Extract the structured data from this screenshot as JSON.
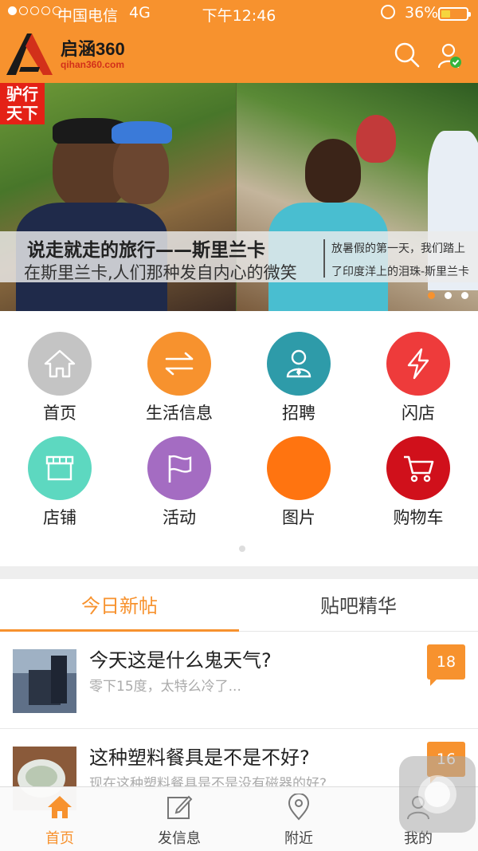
{
  "status_bar": {
    "carrier": "中国电信",
    "network": "4G",
    "time": "下午12:46",
    "battery": "36%",
    "battery_level": 0.36
  },
  "header": {
    "app_name": "启涵360",
    "site": "qihan360.com",
    "icons": [
      "search-icon",
      "user-icon"
    ]
  },
  "banner": {
    "tag": "驴行天下",
    "title": "说走就走的旅行——斯里兰卡",
    "subtitle": "在斯里兰卡,人们那种发自内心的微笑",
    "side_line1": "放暑假的第一天，我们踏上",
    "side_line2": "了印度洋上的泪珠-斯里兰卡",
    "slides": 3,
    "active_slide": 1
  },
  "menu": [
    {
      "label": "首页",
      "icon": "home-icon",
      "color": "#c4c4c4"
    },
    {
      "label": "生活信息",
      "icon": "swap-icon",
      "color": "#f7922e"
    },
    {
      "label": "招聘",
      "icon": "person-icon",
      "color": "#2e9ba9"
    },
    {
      "label": "闪店",
      "icon": "lightning-icon",
      "color": "#ee3b3b"
    },
    {
      "label": "店铺",
      "icon": "store-icon",
      "color": "#5dd8c0"
    },
    {
      "label": "活动",
      "icon": "flag-icon",
      "color": "#a46cc2"
    },
    {
      "label": "图片",
      "icon": "image-icon",
      "color": "#ff7410"
    },
    {
      "label": "购物车",
      "icon": "cart-icon",
      "color": "#d0101b"
    }
  ],
  "tabs": [
    {
      "label": "今日新帖",
      "active": true
    },
    {
      "label": "贴吧精华",
      "active": false
    }
  ],
  "posts": [
    {
      "title": "今天这是什么鬼天气?",
      "desc": "零下15度，太特么冷了...",
      "count": "18"
    },
    {
      "title": "这种塑料餐具是不是不好?",
      "desc": "现在这种塑料餐具是不是没有磁器的好?",
      "count": "16"
    }
  ],
  "bottom_nav": [
    {
      "label": "首页",
      "icon": "home-icon",
      "active": true
    },
    {
      "label": "发信息",
      "icon": "edit-icon",
      "active": false
    },
    {
      "label": "附近",
      "icon": "location-pin-icon",
      "active": false
    },
    {
      "label": "我的",
      "icon": "user-icon",
      "active": false
    }
  ],
  "colors": {
    "accent": "#f7922e",
    "tag_red": "#e42116"
  }
}
